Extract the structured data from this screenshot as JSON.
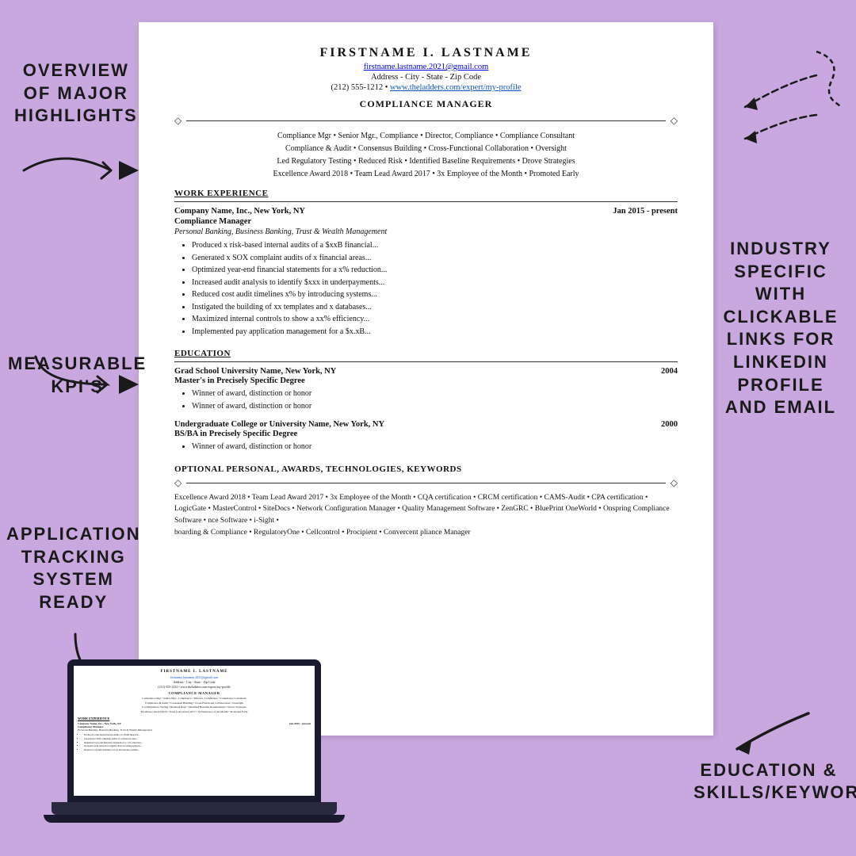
{
  "background_color": "#c9a8e0",
  "labels": {
    "overview": "OVERVIEW\nOF MAJOR\nHIGHLIGHTS",
    "measurable": "MEASURABLE\nKPI'S",
    "ats": "APPLICATION\nTRACKING\nSYSTEM\nREADY",
    "industry": "INDUSTRY\nSPECIFIC\nWITH\nCLICKABLE\nLINKS FOR\nLINKEDIN\nPROFILE\nAND EMAIL",
    "education": "EDUCATION &\nSKILLS/KEYWORDS"
  },
  "resume": {
    "name": "FIRSTNAME I. LASTNAME",
    "email": "firstname.lastname.2021@gmail.com",
    "address": "Address - City - State - Zip Code",
    "phone_website": "(212) 555-1212 • www.theladders.com/expert/my-profile",
    "title": "COMPLIANCE MANAGER",
    "keywords_line1": "Compliance Mgr • Senior Mgr., Compliance • Director, Compliance • Compliance Consultant",
    "keywords_line2": "Compliance & Audit • Consensus Building • Cross-Functional Collaboration • Oversight",
    "keywords_line3": "Led Regulatory Testing • Reduced Risk • Identified Baseline Requirements • Drove Strategies",
    "keywords_line4": "Excellence Award 2018 • Team Lead Award 2017 • 3x Employee of the Month • Promoted Early",
    "work_experience_header": "WORK EXPERIENCE",
    "job1": {
      "company": "Company Name, Inc., New York, NY",
      "dates": "Jan 2015 - present",
      "title": "Compliance Manager",
      "subtitle": "Personal Banking, Business Banking, Trust & Wealth Management",
      "bullets": [
        "Produced x risk-based internal audits of a $xxB financial...",
        "Generated x SOX complaint audits of x financial areas...",
        "Optimized year-end financial statements for a x% reduction...",
        "Increased audit analysis to identify $xxx in underpayments...",
        "Reduced cost audit timelines x% by introducing systems...",
        "Instigated the building of xx templates and x databases...",
        "Maximized internal controls to show a xx% efficiency...",
        "Implemented pay application management for a $x.xB..."
      ]
    },
    "education_header": "EDUCATION",
    "edu1": {
      "school": "Grad School University Name, New York, NY",
      "year": "2004",
      "degree": "Master's in Precisely Specific Degree",
      "bullets": [
        "Winner of award, distinction or honor",
        "Winner of award, distinction or honor"
      ]
    },
    "edu2": {
      "school": "Undergraduate College or University Name, New York, NY",
      "year": "2000",
      "degree": "BS/BA in Precisely Specific Degree",
      "bullets": [
        "Winner of award, distinction or honor"
      ]
    },
    "optional_header": "OPTIONAL PERSONAL, AWARDS, TECHNOLOGIES, KEYWORDS",
    "optional_text": "Excellence Award 2018 • Team Lead Award 2017 • 3x Employee of the Month • CQA certification • CRCM certification • CAMS-Audit • CPA certification • LogicGate • MasterControl • SiteDocs • Network Configuration Manager • Quality Management Software • ZenGRC • BluePrint OneWorld • Onspring Compliance Software • nce Software • i-Sight • boarding & Compliance • RegulatoryOne • Cellcontrol • Procipient • Convercent pliance Manager"
  }
}
